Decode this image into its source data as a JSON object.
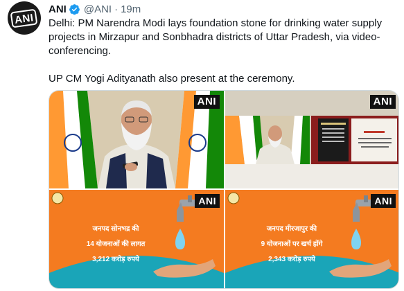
{
  "tweet": {
    "author_name": "ANI",
    "handle": "@ANI",
    "separator": "·",
    "time": "19m",
    "avatar_label": "ANI",
    "text_paragraph_1": "Delhi: PM Narendra Modi lays foundation stone for drinking water supply projects in Mirzapur and Sonbhadra districts of Uttar Pradesh, via video-conferencing.",
    "text_paragraph_2": "UP CM Yogi Adityanath also present at the ceremony."
  },
  "media": {
    "watermark": "ANI",
    "images": [
      {
        "description_icon": "speaker-photo-icon"
      },
      {
        "description_icon": "event-screen-photo-icon"
      },
      {
        "line1": "जनपद सोनभद्र की",
        "line2": "14 योजनाओं की लागत",
        "line3": "3,212 करोड़ रुपये"
      },
      {
        "line1": "जनपद मीरजापुर की",
        "line2": "9 योजनाओं पर खर्च होंगे",
        "line3": "2,343 करोड़ रुपये"
      }
    ]
  },
  "colors": {
    "verified": "#1d9bf0",
    "orange_bg": "#f47b20",
    "teal_arc": "#1aa5b8",
    "saffron": "#ff9933",
    "green": "#138808"
  }
}
